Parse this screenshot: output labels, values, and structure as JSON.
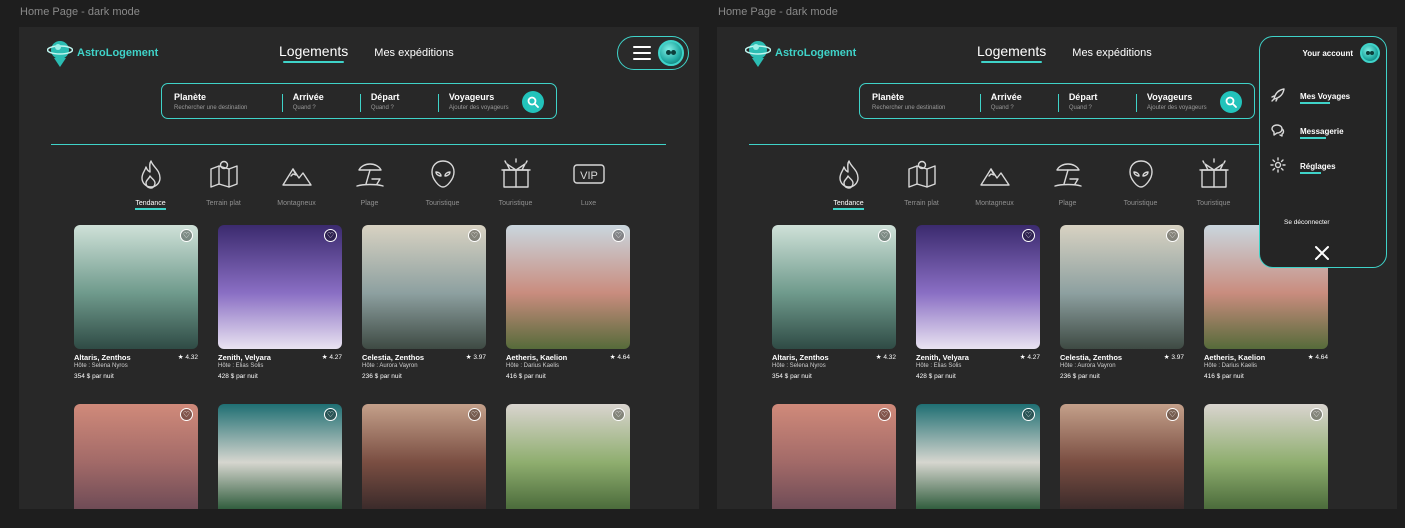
{
  "frames": [
    {
      "label": "Home Page - dark mode"
    },
    {
      "label": "Home Page - dark mode"
    }
  ],
  "brand": {
    "name": "AstroLogement",
    "accent": "#3fd3c9"
  },
  "nav": {
    "primary": "Logements",
    "secondary": "Mes expéditions"
  },
  "menu": {
    "icon": "hamburger-icon",
    "avatar": "alien-avatar-icon"
  },
  "search": {
    "segments": [
      {
        "title": "Planète",
        "sub": "Rechercher une destination"
      },
      {
        "title": "Arrivée",
        "sub": "Quand ?"
      },
      {
        "title": "Départ",
        "sub": "Quand ?"
      },
      {
        "title": "Voyageurs",
        "sub": "Ajouter des voyageurs"
      }
    ],
    "icon": "magnifier-icon"
  },
  "categories": [
    {
      "label": "Tendance",
      "icon": "flame-icon"
    },
    {
      "label": "Terrain plat",
      "icon": "map-icon"
    },
    {
      "label": "Montagneux",
      "icon": "mountain-icon"
    },
    {
      "label": "Plage",
      "icon": "beach-umbrella-icon"
    },
    {
      "label": "Touristique",
      "icon": "alien-icon"
    },
    {
      "label": "Touristique",
      "icon": "gift-box-icon"
    },
    {
      "label": "Luxe",
      "icon": "vip-icon"
    }
  ],
  "listings": [
    {
      "name": "Altaris, Zenthos",
      "rating": "★ 4.32",
      "host": "Hôte : Selena Nyros",
      "price": "354 $ par nuit",
      "colors": [
        "#cfe1d8",
        "#6f9a8c",
        "#2f4b45"
      ]
    },
    {
      "name": "Zenith, Velyara",
      "rating": "★ 4.27",
      "host": "Hôte : Elias Solis",
      "price": "428 $ par nuit",
      "colors": [
        "#3b2a6e",
        "#8a6fc4",
        "#e9e3f1"
      ]
    },
    {
      "name": "Celestia, Zenthos",
      "rating": "★ 3.97",
      "host": "Hôte : Aurora Vayron",
      "price": "236 $ par nuit",
      "colors": [
        "#d8d2c2",
        "#8da0a0",
        "#3e4a43"
      ]
    },
    {
      "name": "Aetheris, Kaelion",
      "rating": "★ 4.64",
      "host": "Hôte : Darius Kaelis",
      "price": "416 $ par nuit",
      "colors": [
        "#c9d6de",
        "#c98c7e",
        "#566b3a"
      ]
    }
  ],
  "listings_row2": [
    {
      "colors": [
        "#d08a7a",
        "#a26a68",
        "#6e4b56"
      ]
    },
    {
      "colors": [
        "#1f6f73",
        "#d6d6cf",
        "#2e5b3b"
      ]
    },
    {
      "colors": [
        "#c4a08a",
        "#7a4e42",
        "#3a2a2a"
      ]
    },
    {
      "colors": [
        "#d9d4cf",
        "#8fae6f",
        "#4a6a3a"
      ]
    }
  ],
  "account_menu": {
    "title": "Your account",
    "items": [
      {
        "label": "Mes Voyages",
        "icon": "rocket-icon"
      },
      {
        "label": "Messagerie",
        "icon": "chat-bubbles-icon"
      },
      {
        "label": "Réglages",
        "icon": "gear-icon"
      }
    ],
    "logout": {
      "label": "Se déconnecter",
      "icon": "logout-icon"
    },
    "close_icon": "close-icon"
  }
}
